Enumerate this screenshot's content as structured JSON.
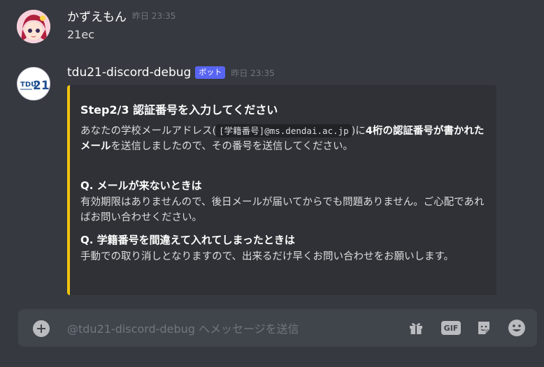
{
  "messages": [
    {
      "author": "かずえもん",
      "timestamp": "昨日 23:35",
      "text": "21ec"
    },
    {
      "author": "tdu21-discord-debug",
      "bot_tag": "ボット",
      "timestamp": "昨日 23:35",
      "avatar_logo_text": "TDU21"
    }
  ],
  "embed": {
    "accent_color": "#f1c40f",
    "title": "Step2/3 認証番号を入力してください",
    "desc_part1": "あなたの学校メールアドレス(",
    "desc_code": "[学籍番号]@ms.dendai.ac.jp",
    "desc_part2": ")に",
    "desc_bold1": "4桁の認証番号が書かれたメール",
    "desc_part3": "を送信しましたので、その番号を送信してください。",
    "fields": [
      {
        "name": "Q. メールが来ないときは",
        "value": "有効期限はありませんので、後日メールが届いてからでも問題ありません。ご心配であればお問い合わせください。"
      },
      {
        "name": "Q. 学籍番号を間違えて入れてしまったときは",
        "value": "手動での取り消しとなりますので、出来るだけ早くお問い合わせをお願いします。"
      }
    ]
  },
  "composer": {
    "placeholder": "@tdu21-discord-debug へメッセージを送信",
    "gif_label": "GIF"
  },
  "icons": [
    "add-icon",
    "gift-icon",
    "gif-icon",
    "sticker-icon",
    "emoji-icon"
  ],
  "colors": {
    "background": "#36393f",
    "bot_tag": "#5865f2",
    "composer": "#40444b"
  }
}
